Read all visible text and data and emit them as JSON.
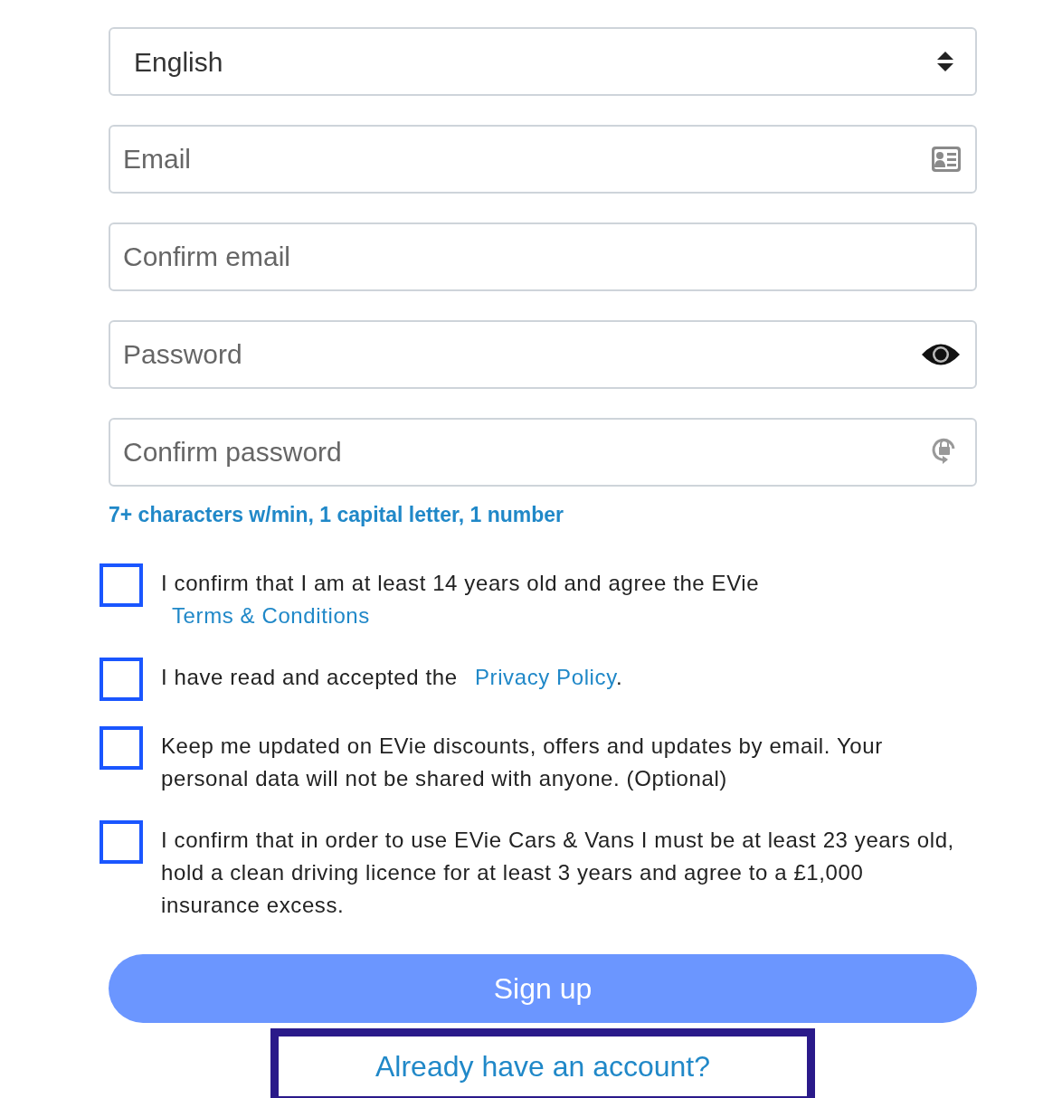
{
  "language_select": {
    "value": "English"
  },
  "fields": [
    {
      "kind": "email",
      "placeholder": "Email"
    },
    {
      "kind": "plain",
      "placeholder": "Confirm email"
    },
    {
      "kind": "password",
      "placeholder": "Password"
    },
    {
      "kind": "confirm_password",
      "placeholder": "Confirm password"
    }
  ],
  "password_hint": "7+ characters w/min, 1 capital letter, 1 number",
  "checkboxes": [
    {
      "checked": false,
      "text": "I confirm that I am at least 14 years old and agree the EVie ",
      "link": "Terms & Conditions"
    },
    {
      "checked": false,
      "text": "I have read and accepted the ",
      "link": "Privacy Policy",
      "after": "."
    },
    {
      "checked": false,
      "text": "Keep me updated on EVie discounts, offers and updates by email. Your personal data will not be shared with anyone. (Optional)"
    },
    {
      "checked": false,
      "text": "I confirm that in order to use EVie Cars & Vans I must be at least 23 years old, hold a clean driving licence for at least 3 years and agree to a £1,000 insurance excess."
    }
  ],
  "signup_button": {
    "label": "Sign up"
  },
  "login_link": {
    "label": "Already have an account?",
    "focused": true
  }
}
